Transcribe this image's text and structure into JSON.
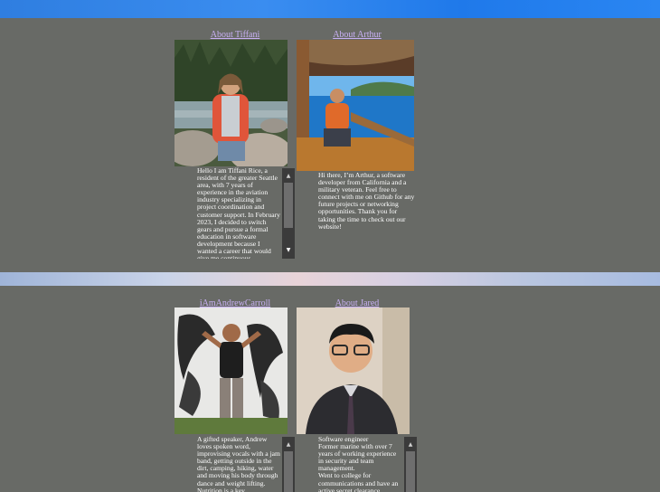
{
  "cards": [
    {
      "link": "About Tiffani",
      "bio": "Hello I am Tiffani Rice, a resident of the greater Seattle area, with 7 years of experience in the aviation industry specializing in project coordination and customer support. In February 2023, I decided to switch gears and pursue a formal education in software development because I wanted a career that would give me continuous"
    },
    {
      "link": "About Arthur",
      "bio": "Hi there, I’m Arthur, a software developer from California and a military veteran. Feel free to connect with me on Github for any future projects or networking opportunities. Thank you for taking the time to check out our website!"
    },
    {
      "link": "iAmAndrewCarroll",
      "bio": "A gifted speaker, Andrew loves spoken word, improvising vocals with a jam band, getting outside in the dirt, camping, hiking, water and moving his body through dance and weight lifting. Nutrition is a key"
    },
    {
      "link": "About Jared",
      "bio": "Software engineer\nFormer marine with over 7 years of working experience in security and team management.\nWent to college for communications and have an active secret clearance."
    }
  ],
  "scroll_up_glyph": "▲",
  "scroll_down_glyph": "▼"
}
